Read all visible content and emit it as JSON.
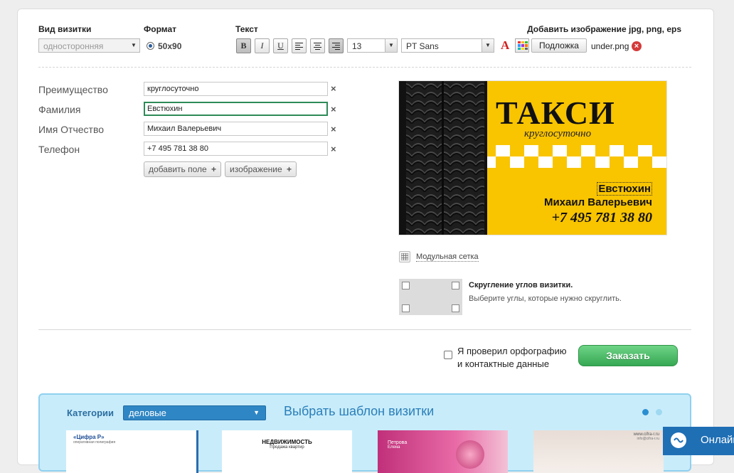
{
  "toolbar": {
    "card_type_label": "Вид визитки",
    "card_type_value": "односторонняя",
    "format_label": "Формат",
    "format_value": "50x90",
    "text_label": "Текст",
    "bold": "B",
    "italic": "I",
    "underline": "U",
    "font_size": "13",
    "font_family": "PT Sans",
    "color_glyph": "A",
    "image_label": "Добавить изображение jpg, png, eps",
    "background_button": "Подложка",
    "background_file": "under.png"
  },
  "form": {
    "fields": [
      {
        "label": "Преимущество",
        "value": "круглосуточно"
      },
      {
        "label": "Фамилия",
        "value": "Евстюхин"
      },
      {
        "label": "Имя Отчество",
        "value": "Михаил Валерьевич"
      },
      {
        "label": "Телефон",
        "value": "+7 495 781 38 80"
      }
    ],
    "remove_glyph": "×",
    "add_field_button": "добавить поле",
    "image_button": "изображение",
    "plus_glyph": "+"
  },
  "preview": {
    "title": "ТАКСИ",
    "subtitle": "круглосуточно",
    "surname": "Евстюхин",
    "name": "Михаил Валерьевич",
    "phone": "+7 495 781 38 80",
    "yellow": "#f9c400",
    "tire": "#1e1e1e"
  },
  "grid_toggle": {
    "label": "Модульная сетка"
  },
  "corners": {
    "title": "Скругление углов визитки.",
    "hint": "Выберите углы, которые нужно скруглить."
  },
  "order": {
    "confirm_line1": "Я проверил орфографию",
    "confirm_line2": "и контактные данные",
    "order_button": "Заказать",
    "button_color": "#4cbf6a"
  },
  "templates": {
    "categories_label": "Категории",
    "category_value": "деловые",
    "heading": "Выбрать шаблон визитки",
    "accent": "#2a7fb8",
    "thumbs": [
      {
        "line1": "«Цифра Р»",
        "line2": "оперативная полиграфия"
      },
      {
        "line1": "НЕДВИЖИМОСТЬ",
        "line2": "Продажа квартир"
      },
      {
        "line1": "Петрова",
        "line2": "Елена"
      },
      {
        "line1": "www.cifra-r.ru",
        "line2": "info@cifra-r.ru"
      }
    ]
  },
  "chat": {
    "label": "Онлайн"
  }
}
